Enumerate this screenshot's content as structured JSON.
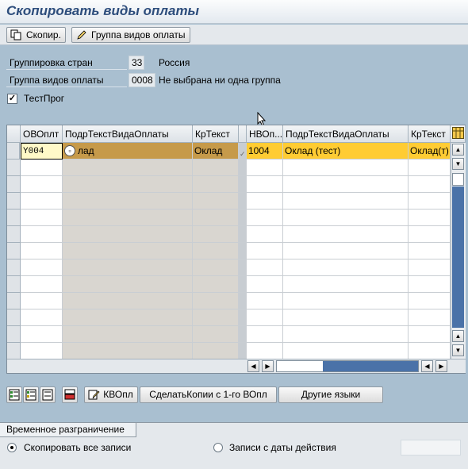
{
  "title": "Скопировать виды оплаты",
  "toolbar": {
    "copy_label": "Скопир.",
    "group_label": "Группа видов оплаты"
  },
  "fields": {
    "country_group_label": "Группировка стран",
    "country_group_value": "33",
    "country_group_text": "Россия",
    "wagetype_group_label": "Группа видов оплаты",
    "wagetype_group_value": "0008",
    "wagetype_group_text": "Не выбрана ни одна группа",
    "test_run_label": "ТестПрог",
    "test_run_checked": true
  },
  "grid": {
    "left_headers": [
      "ОВОплт",
      "ПодрТекстВидаОплаты",
      "КрТекст"
    ],
    "right_headers": [
      "НВОп...",
      "ПодрТекстВидаОплаты",
      "КрТекст"
    ],
    "rows": [
      {
        "source_wt": "Y004",
        "source_long": "лад",
        "source_short": "Оклад",
        "target_wt": "1004",
        "target_long": "Оклад (тест)",
        "target_short": "Оклад(т)"
      }
    ],
    "empty_row_count": 12
  },
  "bottom_buttons": {
    "kvopl_label": "КВОпл",
    "make_copies_label": "СделатьКопии с 1-го ВОпл",
    "other_languages_label": "Другие языки"
  },
  "time_constraint": {
    "group_title": "Временное разграничение",
    "copy_all_label": "Скопировать все записи",
    "from_date_label": "Записи с даты действия",
    "selected": "copy_all"
  }
}
